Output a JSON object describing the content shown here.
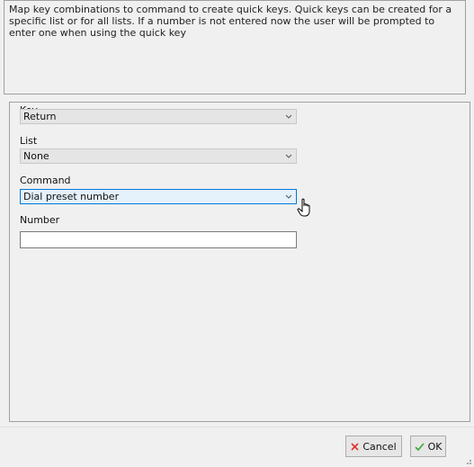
{
  "description": "Map key combinations to command to create quick keys.  Quick keys can be created for a specific list or for all lists.  If a number is not entered now the user will be prompted to enter one when using the quick key",
  "form": {
    "key": {
      "label": "Key",
      "value": "Return"
    },
    "list": {
      "label": "List",
      "value": "None"
    },
    "command": {
      "label": "Command",
      "value": "Dial preset number"
    },
    "number": {
      "label": "Number",
      "value": ""
    }
  },
  "buttons": {
    "cancel": {
      "label": "Cancel",
      "icon": "x-icon",
      "icon_color": "#e03030"
    },
    "ok": {
      "label": "OK",
      "icon": "check-icon",
      "icon_color": "#3aa83a"
    }
  },
  "colors": {
    "focus": "#0078d7"
  }
}
